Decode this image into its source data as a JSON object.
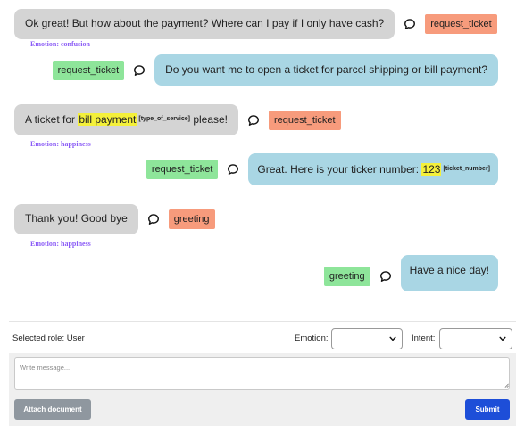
{
  "messages": [
    {
      "role": "user",
      "text": "Ok great! But how about the payment? Where can I pay if I only have cash?",
      "intent": "request_ticket",
      "emotion": "Emotion: confusion"
    },
    {
      "role": "bot",
      "text": "Do you want me to open a ticket for parcel shipping or bill payment?",
      "intent": "request_ticket"
    },
    {
      "role": "user",
      "text_before": "A ticket for ",
      "slot_value": "bill payment",
      "slot_tag": "[type_of_service]",
      "text_after": " please!",
      "intent": "request_ticket",
      "emotion": "Emotion: happiness"
    },
    {
      "role": "bot",
      "text_before": "Great. Here is your ticker number: ",
      "slot_value": "123",
      "slot_tag": "[ticket_number]",
      "intent": "request_ticket"
    },
    {
      "role": "user",
      "text": "Thank you! Good bye",
      "intent": "greeting",
      "emotion": "Emotion: happiness"
    },
    {
      "role": "bot",
      "text": "Have a nice day!",
      "intent": "greeting"
    }
  ],
  "panel": {
    "selected_role": "Selected role: User",
    "emotion_label": "Emotion:",
    "emotion_value": "",
    "intent_label": "Intent:",
    "intent_value": "",
    "message_placeholder": "Write message...",
    "attach_label": "Attach document",
    "submit_label": "Submit"
  },
  "icons": {
    "chat": "speech-bubble-icon",
    "select_arrow": "chevron-down-icon",
    "textarea_grip": "resize-grip-icon"
  },
  "colors": {
    "user_bubble": "#d4d4d4",
    "bot_bubble": "#a9d6e4",
    "user_intent": "#f79b7c",
    "bot_intent": "#8ee59a",
    "highlight": "#f4f03a",
    "emotion_text": "#8b5cf6",
    "submit": "#1d4ed8",
    "attach": "#8f979f"
  }
}
